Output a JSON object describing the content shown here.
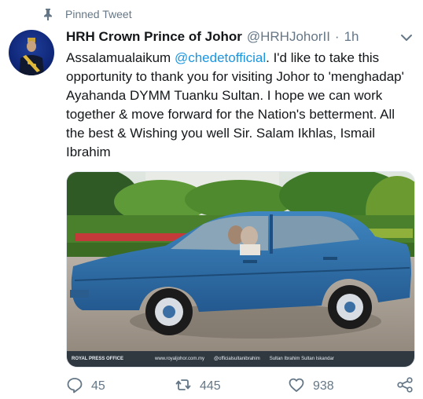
{
  "pinned_label": "Pinned Tweet",
  "tweet": {
    "display_name": "HRH Crown Prince of Johor",
    "handle": "@HRHJohorII",
    "separator": "·",
    "time": "1h",
    "text_before": "Assalamualaikum ",
    "mention": "@chedetofficial",
    "text_after": ". I'd like to take this opportunity to thank you for visiting Johor to 'menghadap' Ayahanda DYMM Tuanku Sultan. I hope we can work together & move forward for the Nation's betterment. All the best & Wishing you well Sir. Salam Ikhlas, Ismail Ibrahim"
  },
  "media": {
    "watermark_left": "ROYAL PRESS OFFICE",
    "watermark_site": "www.royaljohor.com.my",
    "watermark_ig": "@officialsultanibrahim",
    "watermark_fb": "Sultan Ibrahim Sultan Iskandar"
  },
  "actions": {
    "replies": "45",
    "retweets": "445",
    "likes": "938"
  },
  "icons": [
    "pin-icon",
    "chevron-down-icon",
    "reply-icon",
    "retweet-icon",
    "like-icon",
    "share-icon"
  ],
  "colors": {
    "link": "#1b95e0",
    "secondary": "#657786",
    "car": "#2f6fa8"
  }
}
